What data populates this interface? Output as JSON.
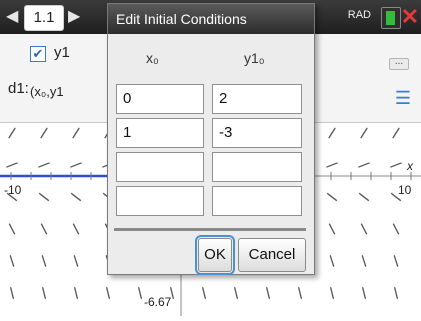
{
  "topbar": {
    "tab_label": "1.1",
    "mode": "RAD",
    "left_arrow": "◀",
    "right_arrow": "▶",
    "close_glyph": "✕"
  },
  "entry": {
    "line_label": "d1:",
    "function_label": "y1",
    "check_glyph": "✔",
    "initial_conditions_label": "(x₀,y1",
    "more_glyph": "...",
    "list_glyph": "☰"
  },
  "graph": {
    "x_min_label": "-10",
    "x_max_label": "10",
    "x_axis_letter": "x",
    "y_label": "-6.67"
  },
  "dialog": {
    "title": "Edit Initial Conditions",
    "col_x_header": "x₀",
    "col_y_header": "y1₀",
    "rows": [
      {
        "x": "0",
        "y": "2"
      },
      {
        "x": "1",
        "y": "-3"
      },
      {
        "x": "",
        "y": ""
      },
      {
        "x": "",
        "y": ""
      }
    ],
    "ok_label": "OK",
    "cancel_label": "Cancel"
  },
  "colors": {
    "axis": "#2f4fd0",
    "slope": "#555555",
    "battery": "#2fbf3a",
    "close": "#e23a3a",
    "focus": "#4a8fd8"
  }
}
